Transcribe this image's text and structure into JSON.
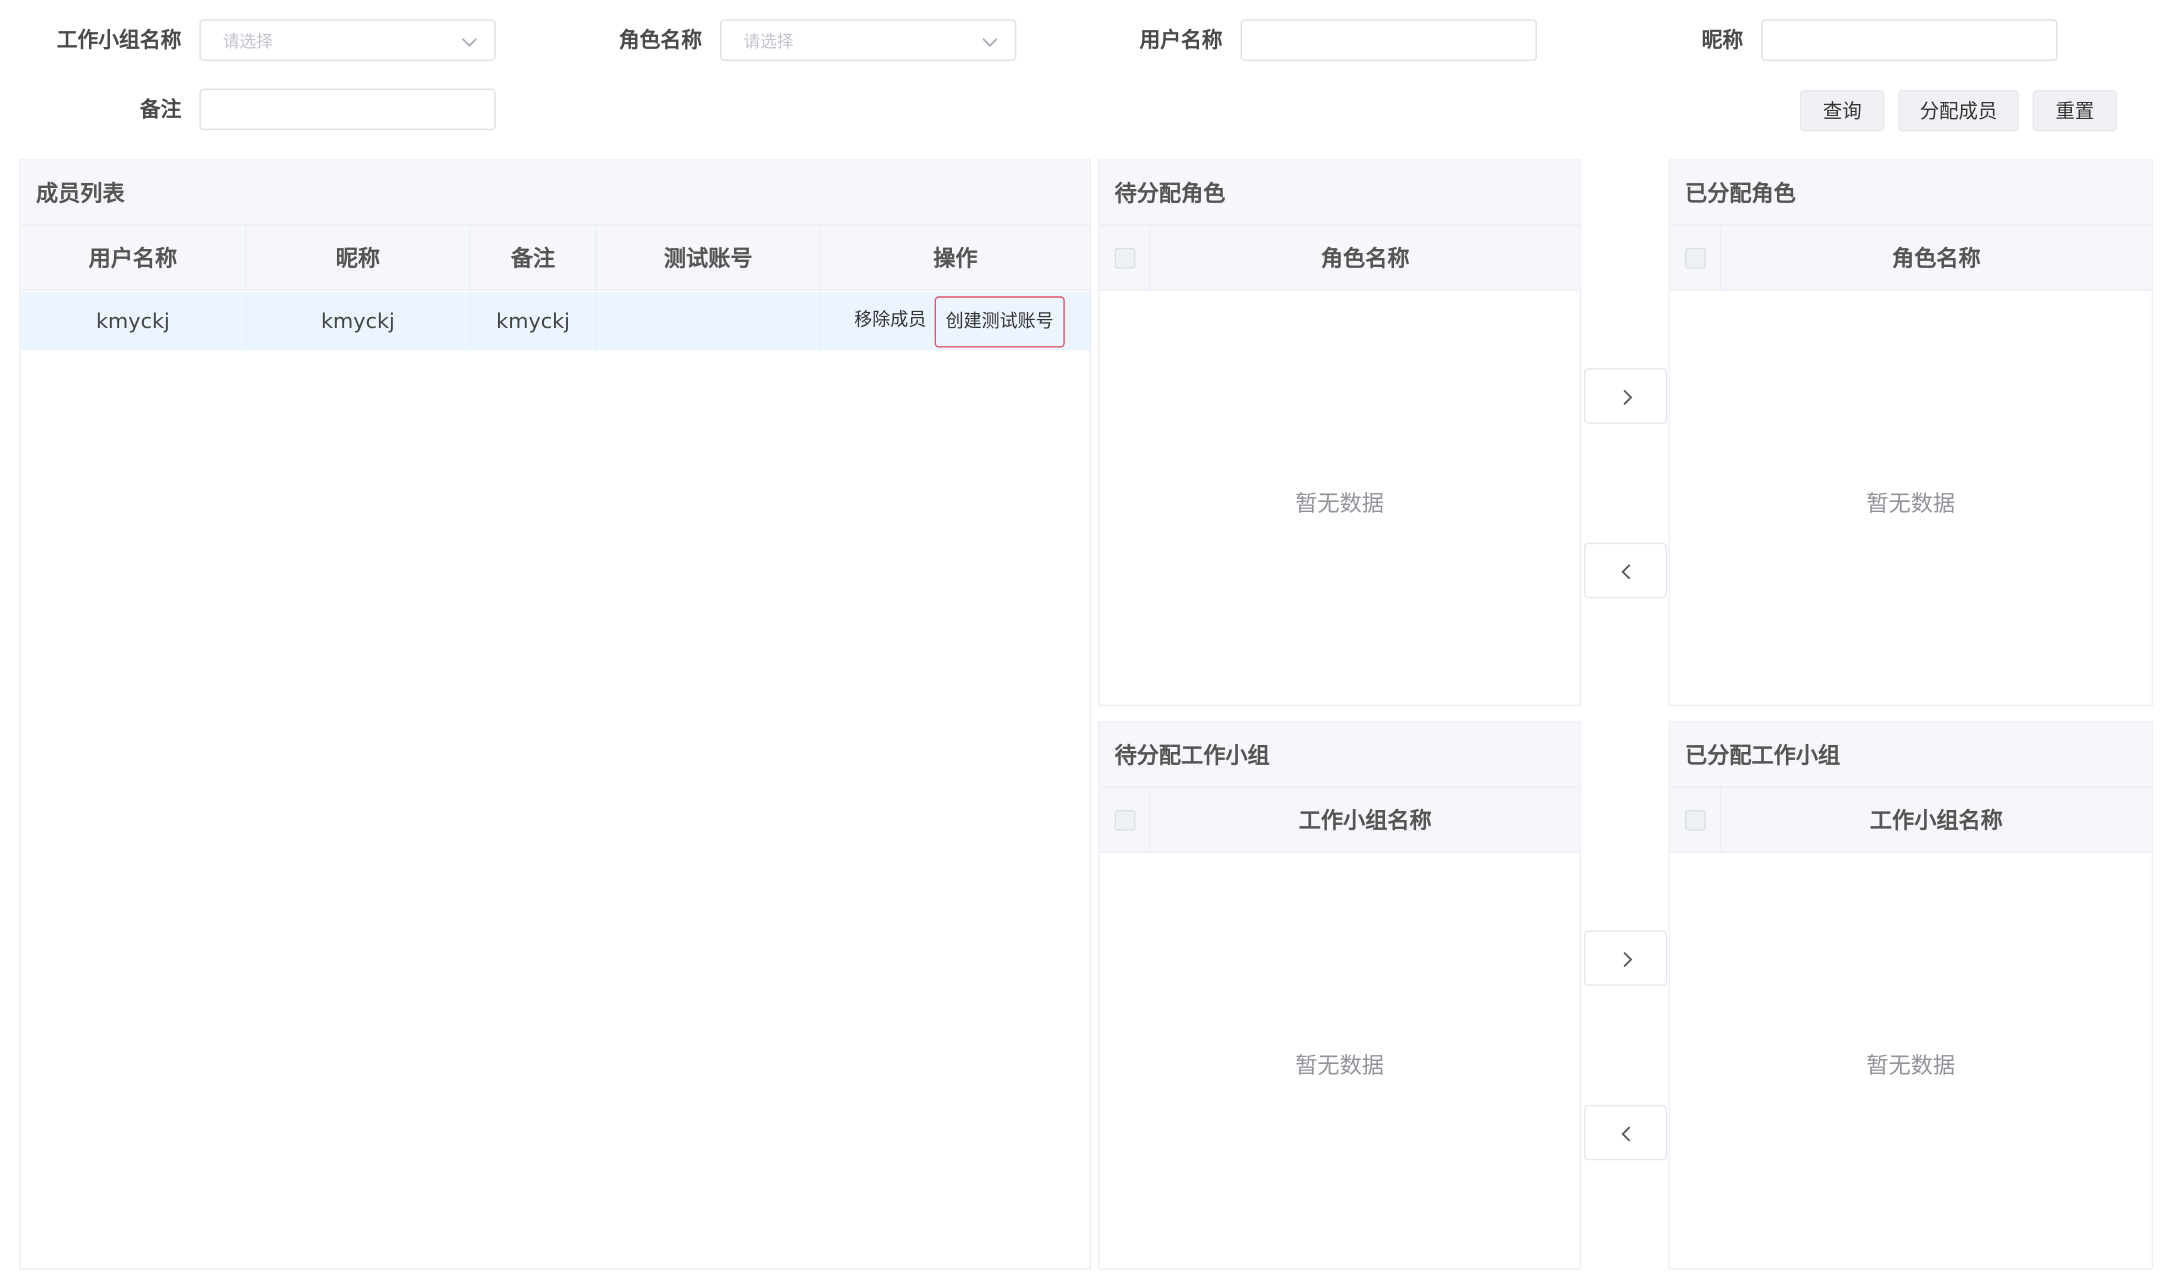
{
  "filters": {
    "workgroup_label": "工作小组名称",
    "workgroup_placeholder": "请选择",
    "role_label": "角色名称",
    "role_placeholder": "请选择",
    "username_label": "用户名称",
    "username_value": "",
    "nickname_label": "昵称",
    "nickname_value": "",
    "remark_label": "备注",
    "remark_value": ""
  },
  "actions": {
    "query": "查询",
    "assign_member": "分配成员",
    "reset": "重置"
  },
  "member_list": {
    "title": "成员列表",
    "columns": [
      "用户名称",
      "昵称",
      "备注",
      "测试账号",
      "操作"
    ],
    "rows": [
      {
        "username": "kmyckj",
        "nickname": "kmyckj",
        "remark": "kmyckj",
        "test_account": "",
        "remove_label": "移除成员",
        "create_test_label": "创建测试账号"
      }
    ]
  },
  "pending_roles": {
    "title": "待分配角色",
    "column": "角色名称",
    "empty_text": "暂无数据"
  },
  "assigned_roles": {
    "title": "已分配角色",
    "column": "角色名称",
    "empty_text": "暂无数据"
  },
  "pending_groups": {
    "title": "待分配工作小组",
    "column": "工作小组名称",
    "empty_text": "暂无数据"
  },
  "assigned_groups": {
    "title": "已分配工作小组",
    "column": "工作小组名称",
    "empty_text": "暂无数据"
  },
  "icons": {
    "select_arrow": "chevron-down-icon",
    "move_right": "chevron-right-icon",
    "move_left": "chevron-left-icon"
  },
  "colors": {
    "header_bg": "#f5f7fa",
    "selected_row_bg": "#ecf5ff",
    "highlight_border": "#e0566a",
    "empty_text": "#909399"
  }
}
